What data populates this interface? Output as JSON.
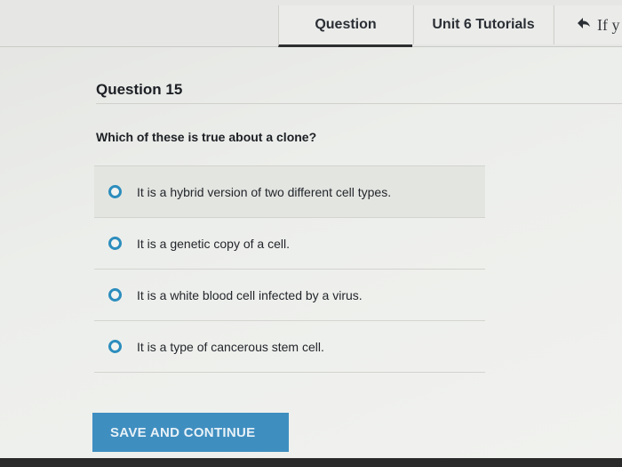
{
  "header": {
    "tabs": [
      {
        "label": "Question",
        "active": true
      },
      {
        "label": "Unit 6 Tutorials",
        "active": false
      }
    ],
    "back": {
      "icon": "back-arrow-icon",
      "label": "If y"
    }
  },
  "question": {
    "title": "Question 15",
    "prompt": "Which of these is true about a clone?",
    "answers": [
      "It is a hybrid version of two different cell types.",
      "It is a genetic copy of a cell.",
      "It is a white blood cell infected by a virus.",
      "It is a type of cancerous stem cell."
    ]
  },
  "actions": {
    "save_label": "SAVE AND CONTINUE"
  },
  "colors": {
    "accent": "#3f8ec0",
    "radio": "#2c8dbd"
  }
}
